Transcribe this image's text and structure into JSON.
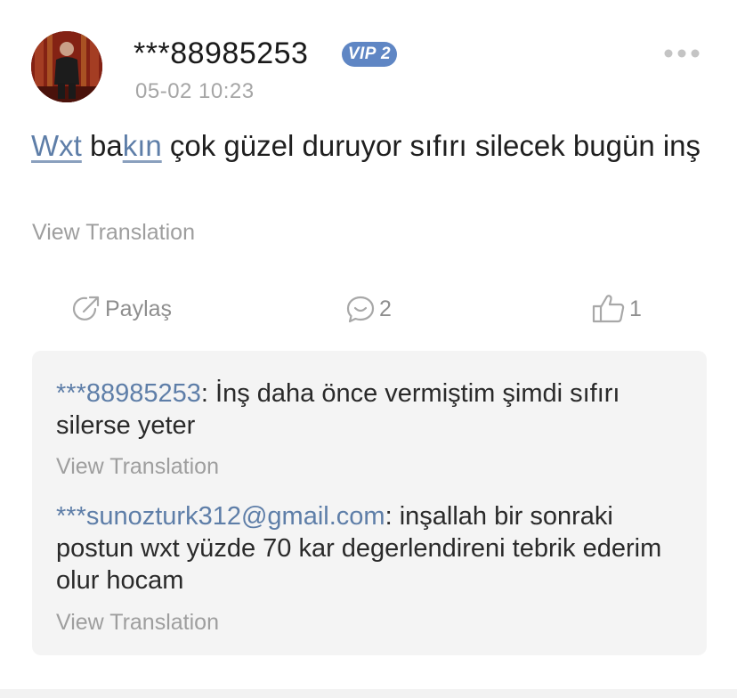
{
  "post": {
    "author": "***88985253",
    "vip_badge": "VIP 2",
    "timestamp": "05-02 10:23",
    "content": {
      "mention_1": "Wxt",
      "text_1": " ba",
      "mention_2": "kın",
      "text_2": " çok güzel duruyor sıfırı silecek bugün inş"
    },
    "view_translation": "View Translation",
    "more_icon": "more-dots-icon"
  },
  "actions": {
    "share_label": "Paylaş",
    "comment_count": "2",
    "like_count": "1",
    "share_icon": "share-icon",
    "comment_icon": "comment-icon",
    "like_icon": "thumbs-up-icon"
  },
  "comments": [
    {
      "author": "***88985253",
      "separator": ": ",
      "text": "İnş daha önce vermiştim şimdi sıfırı silerse yeter",
      "view_translation": "View Translation"
    },
    {
      "author": "***sunozturk312@gmail.com",
      "separator": ": ",
      "text": "inşallah bir sonraki postun wxt yüzde 70 kar degerlendireni tebrik ederim olur hocam",
      "view_translation": "View Translation"
    }
  ],
  "colors": {
    "link": "#5e7ea8",
    "vip_badge": "#5f86c4",
    "muted_text": "#9e9e9e",
    "comment_box_bg": "#f4f4f4"
  }
}
